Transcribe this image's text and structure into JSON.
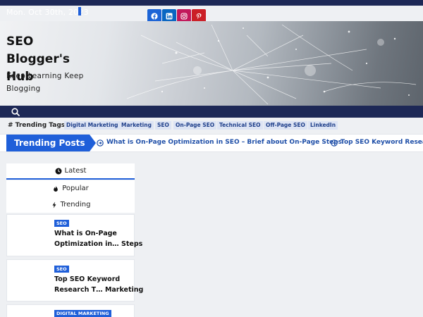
{
  "topbar": {
    "date": "Mon. Oct 30th, 2023",
    "social": [
      {
        "icon": "facebook-icon",
        "color": "#1c64d6"
      },
      {
        "icon": "linkedin-icon",
        "color": "#0a66c2"
      },
      {
        "icon": "instagram-icon",
        "color": "#c2185b"
      },
      {
        "icon": "pinterest-icon",
        "color": "#cb1f27"
      }
    ]
  },
  "header": {
    "site_title": "SEO Blogger's Hub",
    "tagline": "Keep Learning Keep Blogging"
  },
  "nav": {
    "search_icon": "search-icon"
  },
  "trending_tags": {
    "title": "# Trending Tags",
    "tags": [
      "Digital Marketing",
      "Marketing",
      "SEO",
      "On-Page SEO",
      "Technical SEO",
      "Off-Page SEO",
      "LinkedIn"
    ]
  },
  "trending_posts": {
    "label": "Trending Posts",
    "items": [
      "What is On-Page Optimization in SEO – Brief about On-Page Steps",
      "Top SEO Keyword Resea"
    ]
  },
  "widget": {
    "tabs": [
      "Latest",
      "Popular",
      "Trending"
    ],
    "posts": [
      {
        "category": "SEO",
        "title_line1": "What is On-Page",
        "title_line2": "Optimization in…  Steps"
      },
      {
        "category": "SEO",
        "title_line1": "Top SEO Keyword",
        "title_line2": "Research T…  Marketing"
      },
      {
        "category": "DIGITAL MARKETING"
      }
    ]
  },
  "colors": {
    "accent": "#1f5fd9",
    "navy": "#1d2856"
  }
}
